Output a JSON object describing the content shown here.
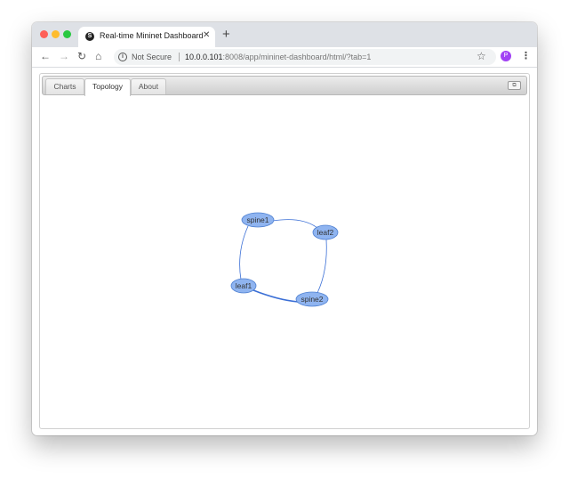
{
  "browser": {
    "tab_title": "Real-time Mininet Dashboard",
    "favicon_letter": "S",
    "new_tab_symbol": "+",
    "close_symbol": "✕",
    "security_label": "Not Secure",
    "url_host": "10.0.0.101",
    "url_rest": ":8008/app/mininet-dashboard/html/?tab=1",
    "profile_initial": "P"
  },
  "app": {
    "tabs": [
      {
        "label": "Charts",
        "active": false
      },
      {
        "label": "Topology",
        "active": true
      },
      {
        "label": "About",
        "active": false
      }
    ]
  },
  "topology": {
    "nodes": [
      {
        "id": "spine1",
        "label": "spine1"
      },
      {
        "id": "leaf2",
        "label": "leaf2"
      },
      {
        "id": "leaf1",
        "label": "leaf1"
      },
      {
        "id": "spine2",
        "label": "spine2"
      }
    ],
    "links": [
      {
        "source": "spine1",
        "target": "leaf2"
      },
      {
        "source": "spine1",
        "target": "leaf1"
      },
      {
        "source": "leaf2",
        "target": "spine2"
      },
      {
        "source": "leaf1",
        "target": "spine2",
        "highlighted": true
      }
    ],
    "node_fill": "#8fb4f0",
    "node_stroke": "#4d7fd1",
    "link_color": "#3b6fd6"
  }
}
